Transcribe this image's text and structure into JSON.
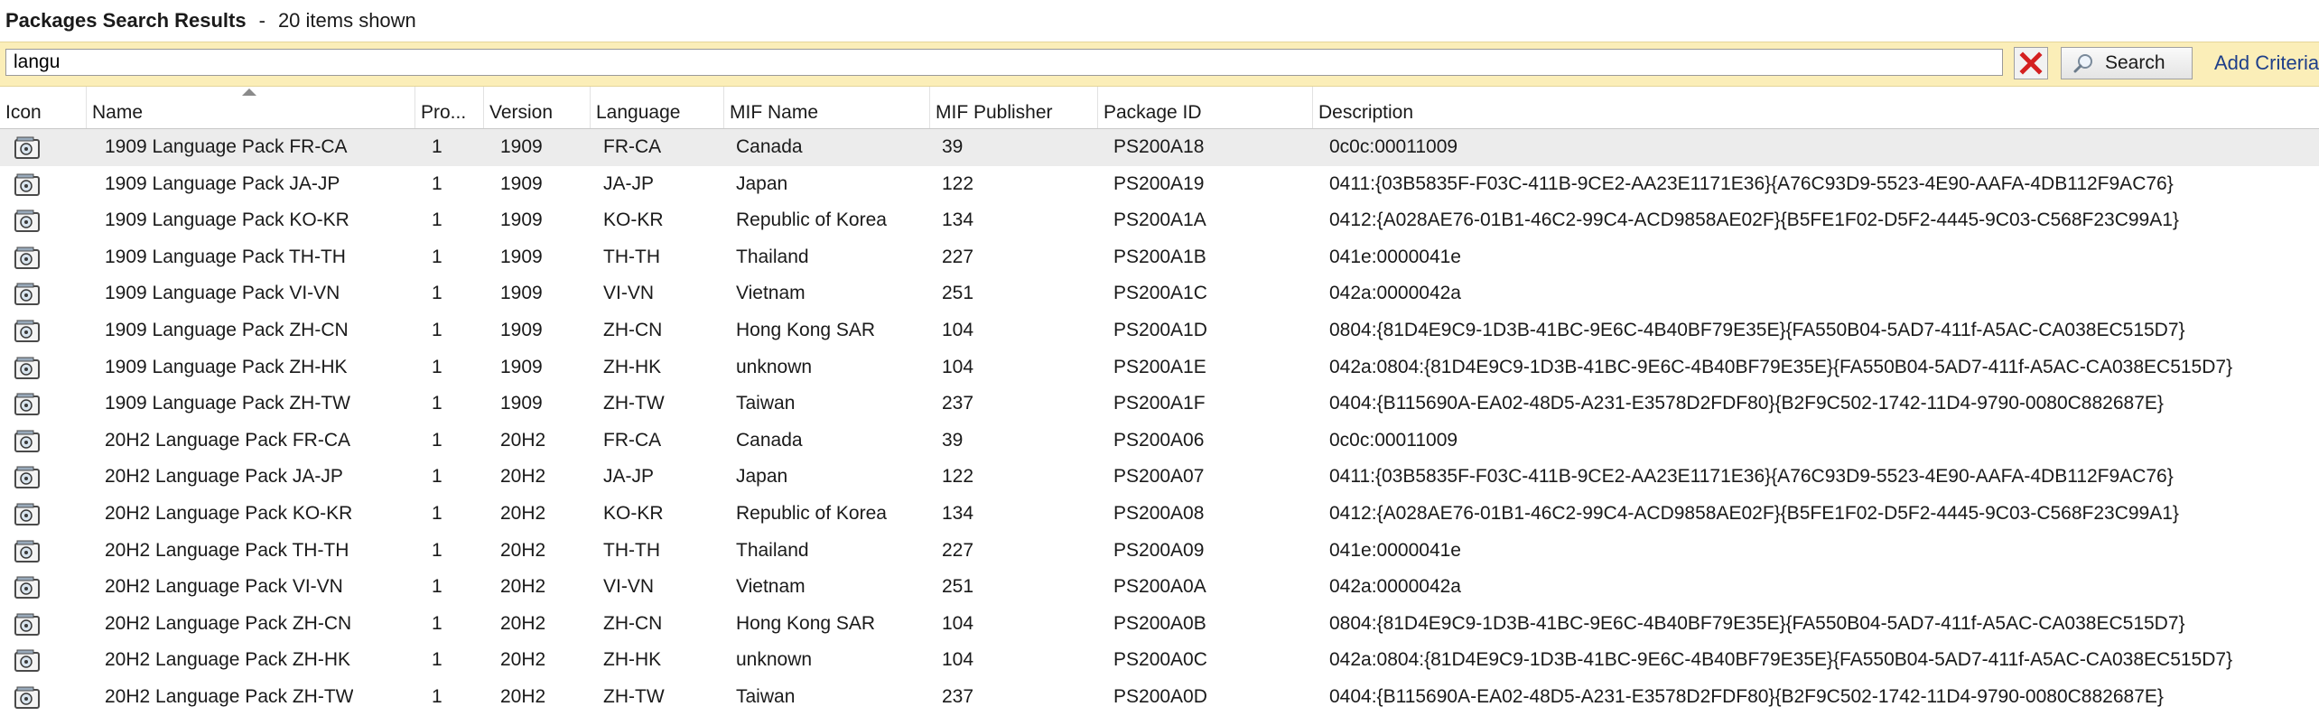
{
  "title": {
    "text": "Packages Search Results",
    "separator": "-",
    "count": "20 items shown"
  },
  "search": {
    "value": "langu",
    "button_label": "Search",
    "add_criteria_label": "Add Criteria"
  },
  "columns": [
    "Icon",
    "Name",
    "Pro...",
    "Version",
    "Language",
    "MIF Name",
    "MIF Publisher",
    "Package ID",
    "Description"
  ],
  "rows": [
    {
      "name": "1909 Language Pack FR-CA",
      "pro": "1",
      "version": "1909",
      "language": "FR-CA",
      "mif_name": "Canada",
      "mif_publisher": "39",
      "package_id": "PS200A18",
      "description": "0c0c:00011009",
      "selected": true
    },
    {
      "name": "1909 Language Pack JA-JP",
      "pro": "1",
      "version": "1909",
      "language": "JA-JP",
      "mif_name": "Japan",
      "mif_publisher": "122",
      "package_id": "PS200A19",
      "description": "0411:{03B5835F-F03C-411B-9CE2-AA23E1171E36}{A76C93D9-5523-4E90-AAFA-4DB112F9AC76}"
    },
    {
      "name": "1909 Language Pack KO-KR",
      "pro": "1",
      "version": "1909",
      "language": "KO-KR",
      "mif_name": "Republic of Korea",
      "mif_publisher": "134",
      "package_id": "PS200A1A",
      "description": "0412:{A028AE76-01B1-46C2-99C4-ACD9858AE02F}{B5FE1F02-D5F2-4445-9C03-C568F23C99A1}"
    },
    {
      "name": "1909 Language Pack TH-TH",
      "pro": "1",
      "version": "1909",
      "language": "TH-TH",
      "mif_name": "Thailand",
      "mif_publisher": "227",
      "package_id": "PS200A1B",
      "description": "041e:0000041e"
    },
    {
      "name": "1909 Language Pack VI-VN",
      "pro": "1",
      "version": "1909",
      "language": "VI-VN",
      "mif_name": "Vietnam",
      "mif_publisher": "251",
      "package_id": "PS200A1C",
      "description": "042a:0000042a"
    },
    {
      "name": "1909 Language Pack ZH-CN",
      "pro": "1",
      "version": "1909",
      "language": "ZH-CN",
      "mif_name": "Hong Kong SAR",
      "mif_publisher": "104",
      "package_id": "PS200A1D",
      "description": "0804:{81D4E9C9-1D3B-41BC-9E6C-4B40BF79E35E}{FA550B04-5AD7-411f-A5AC-CA038EC515D7}"
    },
    {
      "name": "1909 Language Pack ZH-HK",
      "pro": "1",
      "version": "1909",
      "language": "ZH-HK",
      "mif_name": "unknown",
      "mif_publisher": "104",
      "package_id": "PS200A1E",
      "description": "042a:0804:{81D4E9C9-1D3B-41BC-9E6C-4B40BF79E35E}{FA550B04-5AD7-411f-A5AC-CA038EC515D7}"
    },
    {
      "name": "1909 Language Pack ZH-TW",
      "pro": "1",
      "version": "1909",
      "language": "ZH-TW",
      "mif_name": "Taiwan",
      "mif_publisher": "237",
      "package_id": "PS200A1F",
      "description": "0404:{B115690A-EA02-48D5-A231-E3578D2FDF80}{B2F9C502-1742-11D4-9790-0080C882687E}"
    },
    {
      "name": "20H2 Language Pack FR-CA",
      "pro": "1",
      "version": "20H2",
      "language": "FR-CA",
      "mif_name": "Canada",
      "mif_publisher": "39",
      "package_id": "PS200A06",
      "description": "0c0c:00011009"
    },
    {
      "name": "20H2 Language Pack JA-JP",
      "pro": "1",
      "version": "20H2",
      "language": "JA-JP",
      "mif_name": "Japan",
      "mif_publisher": "122",
      "package_id": "PS200A07",
      "description": "0411:{03B5835F-F03C-411B-9CE2-AA23E1171E36}{A76C93D9-5523-4E90-AAFA-4DB112F9AC76}"
    },
    {
      "name": "20H2 Language Pack KO-KR",
      "pro": "1",
      "version": "20H2",
      "language": "KO-KR",
      "mif_name": "Republic of Korea",
      "mif_publisher": "134",
      "package_id": "PS200A08",
      "description": "0412:{A028AE76-01B1-46C2-99C4-ACD9858AE02F}{B5FE1F02-D5F2-4445-9C03-C568F23C99A1}"
    },
    {
      "name": "20H2 Language Pack TH-TH",
      "pro": "1",
      "version": "20H2",
      "language": "TH-TH",
      "mif_name": "Thailand",
      "mif_publisher": "227",
      "package_id": "PS200A09",
      "description": "041e:0000041e"
    },
    {
      "name": "20H2 Language Pack VI-VN",
      "pro": "1",
      "version": "20H2",
      "language": "VI-VN",
      "mif_name": "Vietnam",
      "mif_publisher": "251",
      "package_id": "PS200A0A",
      "description": "042a:0000042a"
    },
    {
      "name": "20H2 Language Pack ZH-CN",
      "pro": "1",
      "version": "20H2",
      "language": "ZH-CN",
      "mif_name": "Hong Kong SAR",
      "mif_publisher": "104",
      "package_id": "PS200A0B",
      "description": "0804:{81D4E9C9-1D3B-41BC-9E6C-4B40BF79E35E}{FA550B04-5AD7-411f-A5AC-CA038EC515D7}"
    },
    {
      "name": "20H2 Language Pack ZH-HK",
      "pro": "1",
      "version": "20H2",
      "language": "ZH-HK",
      "mif_name": "unknown",
      "mif_publisher": "104",
      "package_id": "PS200A0C",
      "description": "042a:0804:{81D4E9C9-1D3B-41BC-9E6C-4B40BF79E35E}{FA550B04-5AD7-411f-A5AC-CA038EC515D7}"
    },
    {
      "name": "20H2 Language Pack ZH-TW",
      "pro": "1",
      "version": "20H2",
      "language": "ZH-TW",
      "mif_name": "Taiwan",
      "mif_publisher": "237",
      "package_id": "PS200A0D",
      "description": "0404:{B115690A-EA02-48D5-A231-E3578D2FDF80}{B2F9C502-1742-11D4-9790-0080C882687E}"
    }
  ],
  "icons": {
    "row_icon": "package-icon",
    "clear": "clear-x-icon",
    "search": "magnifier-icon"
  },
  "colors": {
    "search_bar_bg": "#fbeeb8",
    "selected_row_bg": "#ececec",
    "add_criteria_link": "#1e3f8a",
    "clear_x": "#d42020"
  }
}
